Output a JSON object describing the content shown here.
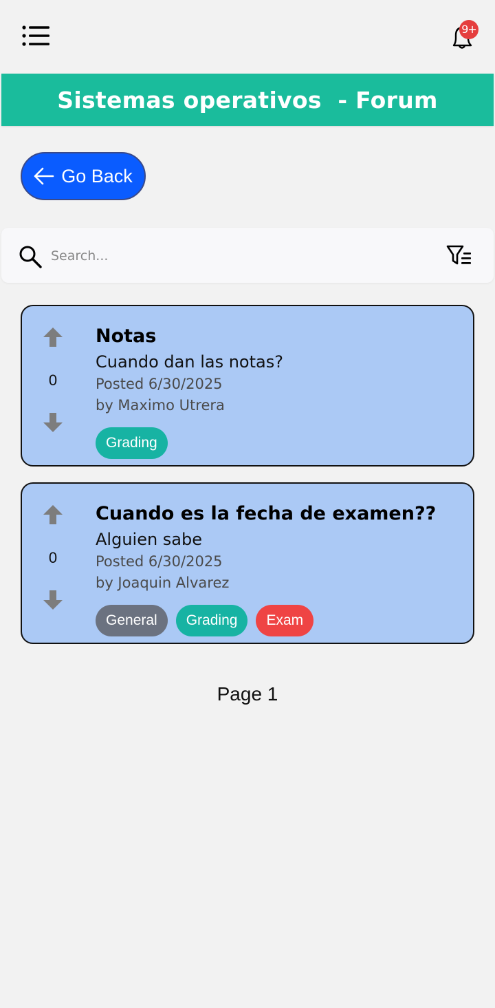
{
  "header": {
    "menu_icon": "list-menu-icon",
    "notification_icon": "bell-icon",
    "notification_badge": "9+",
    "badge_color": "#e53e3e"
  },
  "banner": {
    "title": "Sistemas operativos  - Forum",
    "color": "#1abc9c"
  },
  "back_button": {
    "label": "Go Back",
    "icon": "arrow-left-icon",
    "color": "#0a5cff"
  },
  "search": {
    "placeholder": "Search...",
    "value": "",
    "icon": "search-icon",
    "filter_icon": "filter-icon"
  },
  "posts": [
    {
      "votes": "0",
      "title": "Notas",
      "body": "Cuando dan las notas?",
      "posted": "Posted 6/30/2025",
      "author": "by Maximo Utrera",
      "tags": [
        {
          "label": "Grading",
          "color": "#17b3a3"
        }
      ]
    },
    {
      "votes": "0",
      "title": "Cuando es la fecha de examen??",
      "body": "Alguien sabe",
      "posted": "Posted 6/30/2025",
      "author": "by Joaquin Alvarez",
      "tags": [
        {
          "label": "General",
          "color": "#6b7280"
        },
        {
          "label": "Grading",
          "color": "#17b3a3"
        },
        {
          "label": "Exam",
          "color": "#ef4444"
        }
      ]
    }
  ],
  "card_color": "#abc9f5",
  "pagination": {
    "label": "Page 1"
  }
}
